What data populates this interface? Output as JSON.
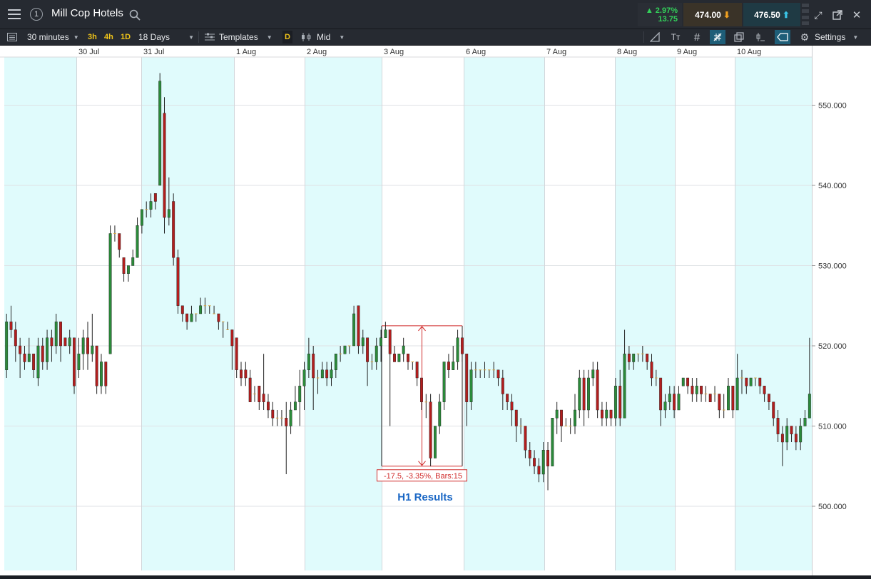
{
  "window": {
    "title": "Mill Cop Hotels",
    "tab_number": "1",
    "change_percent": "▲ 2.97%",
    "change_points": "13.75",
    "sell_price": "474.00",
    "buy_price": "476.50"
  },
  "toolbar": {
    "interval": "30 minutes",
    "quick_intervals": [
      "3h",
      "4h",
      "1D"
    ],
    "range": "18 Days",
    "templates_label": "Templates",
    "d_label": "D",
    "price_type": "Mid",
    "settings_label": "Settings"
  },
  "colors": {
    "up": "#2b8a3a",
    "down": "#b21e1e",
    "shade": "#e0fbfc",
    "accent": "#2aa1d6",
    "annotation": "#d02a2a",
    "event_label": "#1a67c5"
  },
  "chart_data": {
    "type": "candlestick",
    "instrument": "Mill Cop Hotels",
    "interval": "30 minutes",
    "x_tick_labels": [
      "30 Jul",
      "31 Jul",
      "1 Aug",
      "2 Aug",
      "3 Aug",
      "6 Aug",
      "7 Aug",
      "8 Aug",
      "9 Aug",
      "10 Aug"
    ],
    "y_tick_labels": [
      "550.000",
      "540.000",
      "530.000",
      "520.000",
      "510.000",
      "500.000"
    ],
    "ylim": [
      492,
      556
    ],
    "shaded_sessions": [
      "29 Jul",
      "31 Jul",
      "2 Aug",
      "6 Aug",
      "8 Aug",
      "10 Aug"
    ],
    "measurement": {
      "label": "-17.5, -3.35%, Bars:15",
      "from_price": 522.5,
      "to_price": 505.0,
      "bars": 15
    },
    "event_label": "H1 Results",
    "candles": [
      [
        517,
        523,
        524,
        516
      ],
      [
        523,
        522,
        525,
        521
      ],
      [
        522,
        520,
        523,
        518
      ],
      [
        520,
        519,
        521,
        516
      ],
      [
        519,
        518,
        520,
        517
      ],
      [
        518,
        519,
        521,
        518
      ],
      [
        519,
        517,
        519,
        516
      ],
      [
        516,
        520,
        521,
        515
      ],
      [
        520,
        518,
        521,
        517
      ],
      [
        518,
        521,
        522,
        517
      ],
      [
        521,
        520,
        522,
        518
      ],
      [
        520,
        523,
        524,
        519
      ],
      [
        523,
        520,
        523,
        518
      ],
      [
        521,
        520,
        521,
        520
      ],
      [
        520,
        521,
        522,
        519
      ],
      [
        521,
        515,
        521,
        514
      ],
      [
        517,
        519,
        521,
        516
      ],
      [
        519,
        521,
        522,
        517
      ],
      [
        521,
        519,
        523,
        517
      ],
      [
        519,
        520,
        524,
        518
      ],
      [
        520,
        515,
        520,
        514
      ],
      [
        515,
        518,
        519,
        514
      ],
      [
        518,
        515,
        518,
        514
      ],
      [
        519,
        534,
        535,
        519
      ],
      [
        534,
        534,
        535,
        533
      ],
      [
        534,
        532,
        534,
        531
      ],
      [
        531,
        529,
        531,
        528
      ],
      [
        529,
        530,
        530,
        528
      ],
      [
        530,
        531,
        532,
        530
      ],
      [
        531,
        535,
        536,
        531
      ],
      [
        535,
        537,
        537,
        534
      ],
      [
        537,
        537,
        538,
        536
      ],
      [
        537,
        538,
        539,
        536
      ],
      [
        539,
        538,
        539,
        537
      ],
      [
        540,
        553,
        554,
        540
      ],
      [
        549,
        536,
        551,
        534
      ],
      [
        536,
        537,
        541,
        535
      ],
      [
        538,
        531,
        539,
        530
      ],
      [
        531,
        525,
        532,
        524
      ],
      [
        525,
        524,
        525,
        523
      ],
      [
        524,
        523,
        524,
        522
      ],
      [
        523,
        524,
        525,
        523
      ],
      [
        524,
        524,
        524,
        523
      ],
      [
        524,
        525,
        526,
        524
      ],
      [
        525,
        525,
        526,
        524
      ],
      [
        525,
        525,
        525,
        524
      ],
      [
        524,
        524,
        525,
        524
      ],
      [
        524,
        523,
        524,
        522
      ],
      [
        523,
        523,
        523,
        521
      ],
      [
        522,
        522,
        523,
        522
      ],
      [
        522,
        520,
        522,
        517
      ],
      [
        521,
        517,
        521,
        516
      ],
      [
        517,
        516,
        518,
        515
      ],
      [
        517,
        516,
        518,
        515
      ],
      [
        516,
        513,
        517,
        513
      ],
      [
        514,
        514,
        515,
        513
      ],
      [
        515,
        513,
        514,
        512
      ],
      [
        514,
        513,
        519,
        512
      ],
      [
        513,
        512,
        514,
        511
      ],
      [
        512,
        511,
        513,
        510
      ],
      [
        511,
        511,
        512,
        510
      ],
      [
        511,
        511,
        512,
        510
      ],
      [
        511,
        510,
        513,
        504
      ],
      [
        510,
        512,
        513,
        509
      ],
      [
        512,
        513,
        515,
        512
      ],
      [
        513,
        515,
        517,
        510
      ],
      [
        515,
        517,
        518,
        512
      ],
      [
        517,
        519,
        521,
        516
      ],
      [
        519,
        516,
        520,
        512
      ],
      [
        516,
        516,
        517,
        514
      ],
      [
        516,
        517,
        518,
        516
      ],
      [
        517,
        516,
        518,
        515
      ],
      [
        516,
        517,
        518,
        515
      ],
      [
        517,
        519,
        519,
        516
      ],
      [
        519,
        519,
        520,
        518
      ],
      [
        519,
        520,
        520,
        519
      ],
      [
        520,
        520,
        520,
        519
      ],
      [
        520,
        524,
        525,
        520
      ],
      [
        525,
        520,
        525,
        519
      ],
      [
        520,
        521,
        522,
        519
      ],
      [
        521,
        518,
        521,
        515
      ],
      [
        518,
        518,
        519,
        517
      ],
      [
        518,
        520,
        521,
        517
      ],
      [
        520,
        521,
        522,
        518
      ],
      [
        521,
        522,
        523,
        521
      ],
      [
        522,
        519,
        522,
        510
      ],
      [
        519,
        518,
        520,
        518
      ],
      [
        518,
        519,
        519,
        518
      ],
      [
        519,
        520,
        521,
        518
      ],
      [
        519,
        518,
        519,
        517
      ],
      [
        518,
        518,
        518,
        517
      ],
      [
        518,
        516,
        518,
        515
      ],
      [
        516,
        513,
        516,
        512
      ],
      [
        513,
        513,
        514,
        511
      ],
      [
        513,
        506,
        514,
        505
      ],
      [
        506,
        510,
        510,
        506
      ],
      [
        510,
        513,
        514,
        509
      ],
      [
        513,
        518,
        518,
        512
      ],
      [
        518,
        517,
        519,
        516
      ],
      [
        517,
        518,
        520,
        517
      ],
      [
        518,
        521,
        522,
        517
      ],
      [
        521,
        519,
        521,
        518
      ],
      [
        519,
        513,
        519,
        510
      ],
      [
        513,
        517,
        518,
        512
      ],
      [
        517,
        517,
        518,
        516
      ],
      [
        517,
        517,
        517,
        516
      ],
      [
        517,
        517,
        518,
        516
      ],
      [
        517,
        517,
        517,
        516
      ],
      [
        517,
        517,
        518,
        516
      ],
      [
        517,
        516,
        517,
        515
      ],
      [
        516,
        514,
        517,
        512
      ],
      [
        514,
        513,
        514,
        512
      ],
      [
        513,
        512,
        514,
        510
      ],
      [
        512,
        510,
        512,
        508
      ],
      [
        510,
        510,
        511,
        509
      ],
      [
        510,
        507,
        510,
        506
      ],
      [
        507,
        506,
        508,
        505
      ],
      [
        506,
        505,
        507,
        504
      ],
      [
        505,
        504,
        506,
        503
      ],
      [
        504,
        507,
        508,
        503
      ],
      [
        507,
        505,
        508,
        502
      ],
      [
        505,
        511,
        511,
        505
      ],
      [
        511,
        512,
        513,
        509
      ],
      [
        512,
        510,
        512,
        508
      ],
      [
        510,
        510,
        511,
        510
      ],
      [
        510,
        510,
        511,
        509
      ],
      [
        510,
        512,
        514,
        509
      ],
      [
        512,
        516,
        517,
        511
      ],
      [
        516,
        512,
        517,
        510
      ],
      [
        512,
        516,
        517,
        511
      ],
      [
        516,
        517,
        518,
        515
      ],
      [
        517,
        512,
        518,
        511
      ],
      [
        512,
        511,
        513,
        510
      ],
      [
        511,
        512,
        513,
        510
      ],
      [
        512,
        511,
        512,
        510
      ],
      [
        511,
        515,
        516,
        510
      ],
      [
        515,
        511,
        517,
        510
      ],
      [
        511,
        519,
        522,
        511
      ],
      [
        519,
        518,
        520,
        517
      ],
      [
        518,
        519,
        519,
        517
      ],
      [
        519,
        519,
        519,
        518
      ],
      [
        519,
        519,
        520,
        518
      ],
      [
        519,
        518,
        519,
        517
      ],
      [
        518,
        516,
        519,
        515
      ],
      [
        516,
        516,
        517,
        515
      ],
      [
        516,
        512,
        516,
        510
      ],
      [
        512,
        513,
        514,
        511
      ],
      [
        513,
        514,
        515,
        512
      ],
      [
        514,
        512,
        515,
        511
      ],
      [
        512,
        514,
        515,
        512
      ],
      [
        515,
        516,
        516,
        515
      ],
      [
        516,
        515,
        516,
        514
      ],
      [
        515,
        514,
        516,
        513
      ],
      [
        514,
        515,
        516,
        513
      ],
      [
        515,
        514,
        515,
        513
      ],
      [
        514,
        514,
        515,
        513
      ],
      [
        514,
        513,
        514,
        513
      ],
      [
        514,
        514,
        515,
        513
      ],
      [
        514,
        512,
        514,
        511
      ],
      [
        512,
        512,
        514,
        511
      ],
      [
        512,
        515,
        516,
        512
      ],
      [
        515,
        512,
        515,
        511
      ],
      [
        512,
        516,
        519,
        512
      ],
      [
        516,
        516,
        517,
        514
      ],
      [
        516,
        515,
        516,
        514
      ],
      [
        515,
        516,
        516,
        515
      ],
      [
        516,
        516,
        516,
        515
      ],
      [
        516,
        515,
        516,
        514
      ],
      [
        515,
        514,
        515,
        513
      ],
      [
        514,
        513,
        514,
        512
      ],
      [
        513,
        511,
        513,
        510
      ],
      [
        511,
        509,
        512,
        508
      ],
      [
        509,
        508,
        510,
        505
      ],
      [
        508,
        510,
        511,
        507
      ],
      [
        510,
        509,
        510,
        508
      ],
      [
        509,
        508,
        510,
        507
      ],
      [
        508,
        510,
        511,
        507
      ],
      [
        510,
        511,
        512,
        510
      ],
      [
        511,
        514,
        521,
        511
      ]
    ]
  }
}
